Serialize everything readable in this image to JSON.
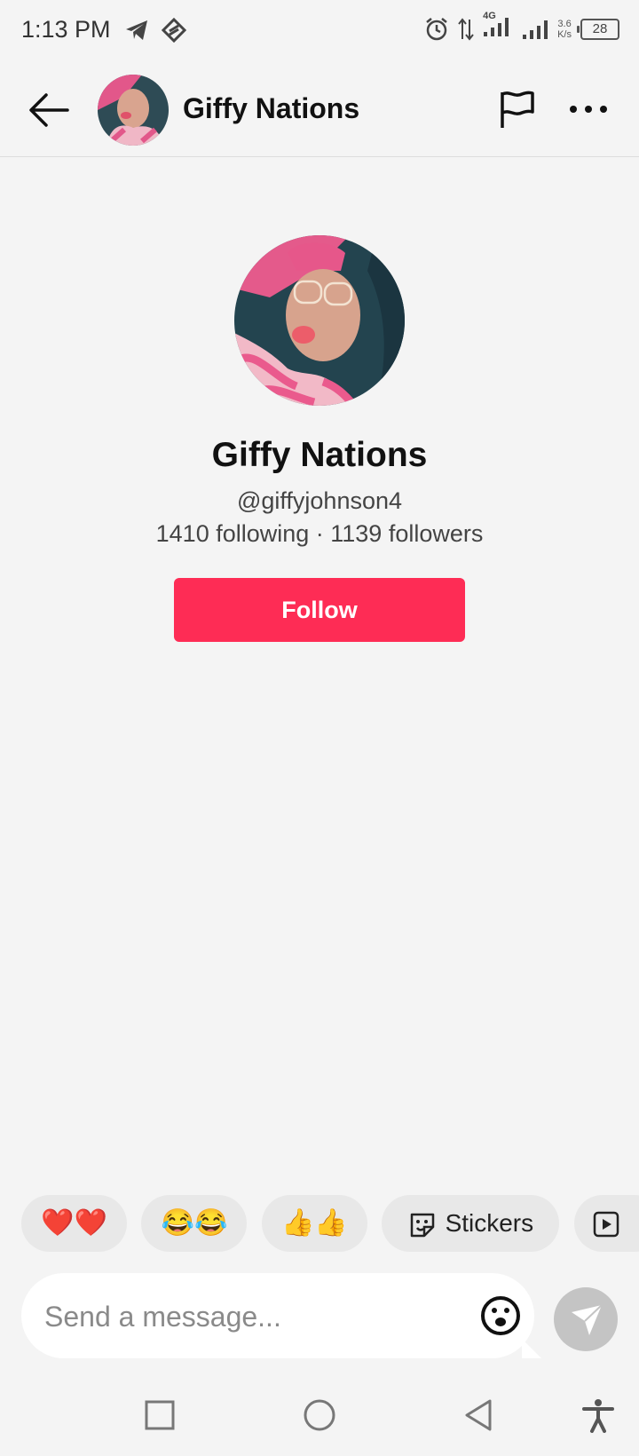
{
  "status_bar": {
    "time": "1:13 PM",
    "network_type": "4G",
    "net_speed_value": "3.6",
    "net_speed_unit": "K/s",
    "battery": "28",
    "icons": [
      "telegram-icon",
      "app-icon",
      "alarm-icon",
      "data-arrows-icon",
      "signal-icon",
      "signal-icon",
      "battery-icon"
    ]
  },
  "header": {
    "title": "Giffy Nations",
    "icons": [
      "back-arrow-icon",
      "avatar",
      "flag-icon",
      "more-icon"
    ]
  },
  "profile": {
    "name": "Giffy Nations",
    "handle": "@giffyjohnson4",
    "stats": "1410 following · 1139 followers",
    "follow_label": "Follow"
  },
  "quick_replies": {
    "items": [
      "❤️❤️",
      "😂😂",
      "👍👍"
    ],
    "stickers_label": "Stickers"
  },
  "composer": {
    "placeholder": "Send a message..."
  },
  "colors": {
    "accent": "#fe2c55",
    "background": "#f4f4f4",
    "send_button": "#c4c4c4"
  },
  "nav_icons": [
    "recents-square-icon",
    "home-circle-icon",
    "back-triangle-icon",
    "accessibility-icon"
  ]
}
